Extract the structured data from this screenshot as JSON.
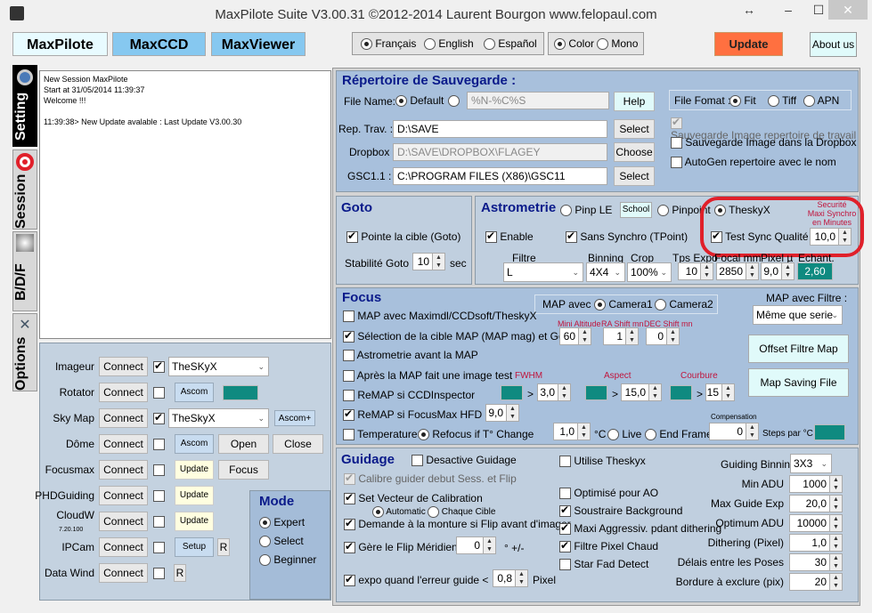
{
  "window": {
    "title": "MaxPilote Suite  V3.00.31  ©2012-2014 Laurent Bourgon  www.felopaul.com",
    "controls": {
      "resize": "↔",
      "minimize": "–",
      "maximize": "☐",
      "close": "✕"
    }
  },
  "app_tabs": [
    "MaxPilote",
    "MaxCCD",
    "MaxViewer"
  ],
  "language": {
    "options": [
      "Français",
      "English",
      "Español"
    ],
    "selected": "Français"
  },
  "display_mode": {
    "options": [
      "Color",
      "Mono"
    ],
    "selected": "Color"
  },
  "update_button": "Update",
  "about_button": "About us",
  "side_tabs": [
    {
      "label": "Setting",
      "icon": "gear-icon"
    },
    {
      "label": "Session",
      "icon": "target-icon"
    },
    {
      "label": "B/D/F",
      "icon": "flat-icon"
    },
    {
      "label": "Options",
      "icon": "tools-icon"
    }
  ],
  "log": [
    "New Session MaxPilote",
    "Start at 31/05/2014 11:39:37",
    "Welcome !!!",
    "",
    "11:39:38> New Update avalable : Last Update V3.00.30"
  ],
  "devices": [
    {
      "label": "Imageur",
      "connect": "Connect",
      "checked": true,
      "select": "TheSKyX"
    },
    {
      "label": "Rotator",
      "connect": "Connect",
      "checked": false,
      "extra": "Ascom"
    },
    {
      "label": "Sky Map",
      "connect": "Connect",
      "checked": true,
      "select": "TheSkyX",
      "extra": "Ascom+"
    },
    {
      "label": "Dôme",
      "connect": "Connect",
      "checked": false,
      "extra": "Ascom",
      "btn2": "Open",
      "btn3": "Close"
    },
    {
      "label": "Focusmax",
      "connect": "Connect",
      "checked": false,
      "extra": "Update",
      "btn2": "Focus"
    },
    {
      "label": "PHDGuiding",
      "connect": "Connect",
      "checked": false,
      "extra": "Update"
    },
    {
      "label": "CloudW",
      "sublabel": "7.20.100",
      "connect": "Connect",
      "checked": false,
      "extra": "Update"
    },
    {
      "label": "IPCam",
      "connect": "Connect",
      "checked": false,
      "extra": "Setup",
      "r": "R"
    },
    {
      "label": "Data Wind",
      "connect": "Connect",
      "checked": false,
      "r": "R"
    }
  ],
  "mode": {
    "title": "Mode",
    "options": [
      "Expert",
      "Select",
      "Beginner"
    ],
    "selected": "Expert"
  },
  "save": {
    "title": "Répertoire de Sauvegarde :",
    "file_name_label": "File Name:",
    "default_label": "Default",
    "pattern": "%N-%C%S",
    "help": "Help",
    "rep_trav_label": "Rep. Trav. :",
    "rep_trav": "D:\\SAVE",
    "select1": "Select",
    "dropbox_label": "Dropbox :",
    "dropbox": "D:\\SAVE\\DROPBOX\\FLAGEY",
    "choose": "Choose",
    "gsc_label": "GSC1.1 :",
    "gsc": "C:\\PROGRAM FILES (X86)\\GSC11",
    "select2": "Select",
    "file_format_label": "File Fomat :",
    "formats": [
      "Fit",
      "Tiff",
      "APN"
    ],
    "format_selected": "Fit",
    "opt1": "Sauvegarde Image repertoire de travail",
    "opt2": "Sauvegarde Image dans la  Dropbox",
    "opt3": "AutoGen repertoire avec le nom"
  },
  "goto": {
    "title": "Goto",
    "pointe": "Pointe la cible (Goto)",
    "stab_label": "Stabilité Goto",
    "stab_value": "10",
    "unit": "sec"
  },
  "astro": {
    "title": "Astrometrie",
    "pinple": "Pinp LE",
    "school": "School",
    "pinpoint": "Pinpoint",
    "theskyx": "TheskyX",
    "enable": "Enable",
    "sans_synchro": "Sans Synchro (TPoint)",
    "test_sync": "Test Sync Qualité",
    "securite": "Securité",
    "maxi_synchro": "Maxi Synchro",
    "en_minutes": "en Minutes",
    "sync_value": "10,0",
    "filtre_label": "Filtre",
    "filtre": "L",
    "binning_label": "Binning",
    "binning": "4X4",
    "crop_label": "Crop",
    "crop": "100%",
    "tps_label": "Tps Expo",
    "tps": "10",
    "focal_label": "Focal mm",
    "focal": "2850",
    "pixel_label": "Pixel µ",
    "pixel": "9,0",
    "echant_label": "Echant.",
    "echant": "2,60"
  },
  "focus": {
    "title": "Focus",
    "map_avec": "MAP avec",
    "cameras": [
      "Camera1",
      "Camera2"
    ],
    "camera_selected": "Camera1",
    "map_filtre_label": "MAP avec Filtre :",
    "map_filtre": "Même que serie",
    "offset_btn": "Offset Filtre Map",
    "saving_btn": "Map Saving File",
    "opt_maxim": "MAP avec Maximdl/CCDsoft/TheskyX",
    "opt_selection": "Sélection de la cible MAP (MAP mag) et Goto",
    "opt_astro": "Astrometrie avant la MAP",
    "opt_apres": "Après la MAP fait une image test",
    "opt_ccdi": "ReMAP si CCDInspector",
    "opt_hfd": "ReMAP si FocusMax HFD >",
    "opt_temp": "Temperature",
    "refocus": "Refocus if  T°  Change",
    "mini_alt_label": "Mini Altitude",
    "mini_alt": "60",
    "ra_label": "RA Shift mn",
    "ra": "1",
    "dec_label": "DEC Shift mn",
    "dec": "0",
    "fwhm_label": "FWHM",
    "fwhm": "3,0",
    "aspect_label": "Aspect",
    "aspect": "15,0",
    "courbure_label": "Courbure",
    "courbure": "15",
    "hfd": "9,0",
    "temp_change": "1,0",
    "degc": "°C",
    "live": "Live",
    "end_frame": "End Frame",
    "compensation_label": "Compensation",
    "compensation": "0",
    "steps": "Steps par °C",
    "gt": ">"
  },
  "guide": {
    "title": "Guidage",
    "desactive": "Desactive Guidage",
    "calibre": "Calibre guider debut Sess. et Flip",
    "set_vecteur": "Set Vecteur de Calibration",
    "automatic": "Automatic",
    "chaque": "Chaque Cible",
    "demande": "Demande à la monture si Flip avant d'imager",
    "gere_flip": "Gère le Flip Méridien",
    "flip_value": "0",
    "flip_unit": "° +/-",
    "expo": "expo quand  l'erreur guide <",
    "expo_value": "0,8",
    "expo_unit": "Pixel",
    "utilise": "Utilise Theskyx",
    "optimise": "Optimisé pour  AO",
    "soustraire": "Soustraire Background",
    "maxi_agg": "Maxi Aggressiv. pdant dithering",
    "filtre_pixel": "Filtre Pixel Chaud",
    "star_fad": "Star Fad Detect",
    "binning_label": "Guiding Binning",
    "binning": "3X3",
    "fields": [
      {
        "label": "Min ADU",
        "value": "1000"
      },
      {
        "label": "Max Guide Exp",
        "value": "20,0"
      },
      {
        "label": "Optimum ADU",
        "value": "10000"
      },
      {
        "label": "Dithering (Pixel)",
        "value": "1,0"
      },
      {
        "label": "Délais entre les Poses",
        "value": "30"
      },
      {
        "label": "Bordure à exclure (pix)",
        "value": "20"
      }
    ]
  },
  "colors": {
    "teal": "#0f8a80",
    "update": "#ff7040",
    "highlight_ring": "#e0202a",
    "section_title": "#0a1a8a"
  }
}
